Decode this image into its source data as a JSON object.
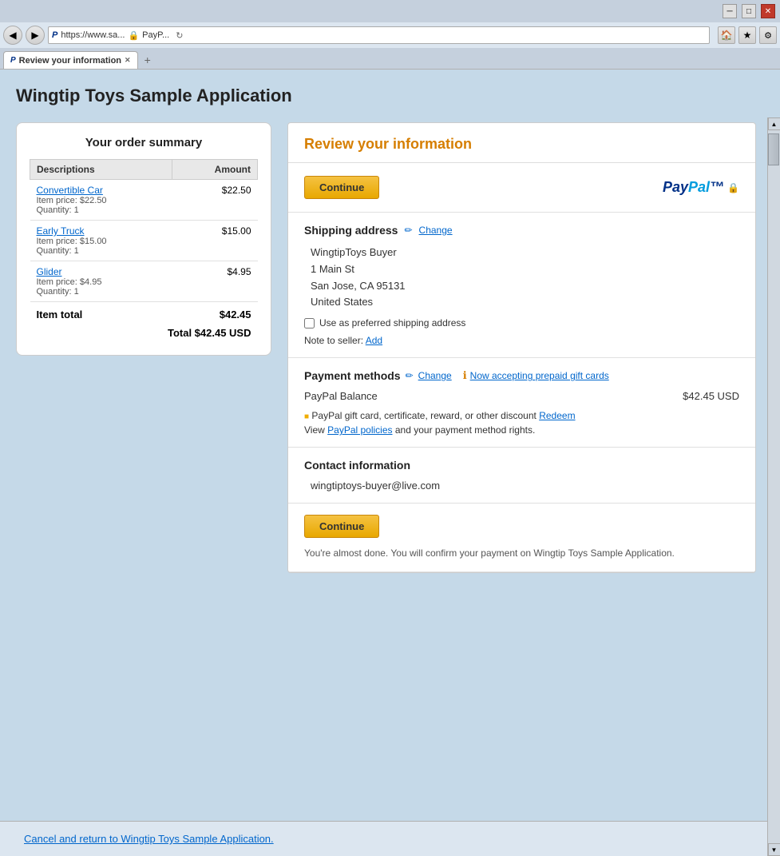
{
  "browser": {
    "title_bar": {
      "minimize": "─",
      "restore": "□",
      "close": "✕"
    },
    "nav": {
      "back": "◀",
      "forward": "▶",
      "address": "https://www.sa...",
      "paypal_label": "PayP...",
      "new_tab_plus": "+"
    },
    "tabs": [
      {
        "label": "Review your information",
        "active": true,
        "close": "✕"
      }
    ]
  },
  "page": {
    "title": "Wingtip Toys Sample Application",
    "review_heading": "Review your information"
  },
  "order_summary": {
    "title": "Your order summary",
    "table_headers": [
      "Descriptions",
      "Amount"
    ],
    "items": [
      {
        "name": "Convertible Car",
        "price": "$22.50",
        "item_price_label": "Item price: $22.50",
        "quantity_label": "Quantity: 1",
        "amount": "$22.50"
      },
      {
        "name": "Early Truck",
        "price": "$15.00",
        "item_price_label": "Item price: $15.00",
        "quantity_label": "Quantity: 1",
        "amount": "$15.00"
      },
      {
        "name": "Glider",
        "price": "$4.95",
        "item_price_label": "Item price: $4.95",
        "quantity_label": "Quantity: 1",
        "amount": "$4.95"
      }
    ],
    "item_total_label": "Item total",
    "item_total_amount": "$42.45",
    "total_label": "Total $42.45 USD"
  },
  "review": {
    "continue_btn": "Continue",
    "paypal_text": "PayPal",
    "shipping_title": "Shipping address",
    "shipping_change": "Change",
    "buyer_name": "WingtipToys Buyer",
    "address_line1": "1 Main St",
    "address_line2": "San Jose, CA 95131",
    "address_line3": "United States",
    "preferred_shipping_label": "Use as preferred shipping address",
    "note_label": "Note to seller:",
    "note_add": "Add",
    "payment_title": "Payment methods",
    "payment_change": "Change",
    "prepaid_gift_label": "Now accepting prepaid gift cards",
    "payment_method_name": "PayPal Balance",
    "payment_amount": "$42.45 USD",
    "gift_card_text": "PayPal gift card, certificate, reward, or other discount",
    "redeem_link": "Redeem",
    "policies_text": "View",
    "policies_link": "PayPal policies",
    "policies_text2": "and your payment method rights.",
    "contact_title": "Contact information",
    "contact_email": "wingtiptoys-buyer@live.com",
    "continue_btn2": "Continue",
    "almost_done_text": "You're almost done. You will confirm your payment on Wingtip Toys Sample Application.",
    "cancel_link": "Cancel and return to Wingtip Toys Sample Application."
  }
}
